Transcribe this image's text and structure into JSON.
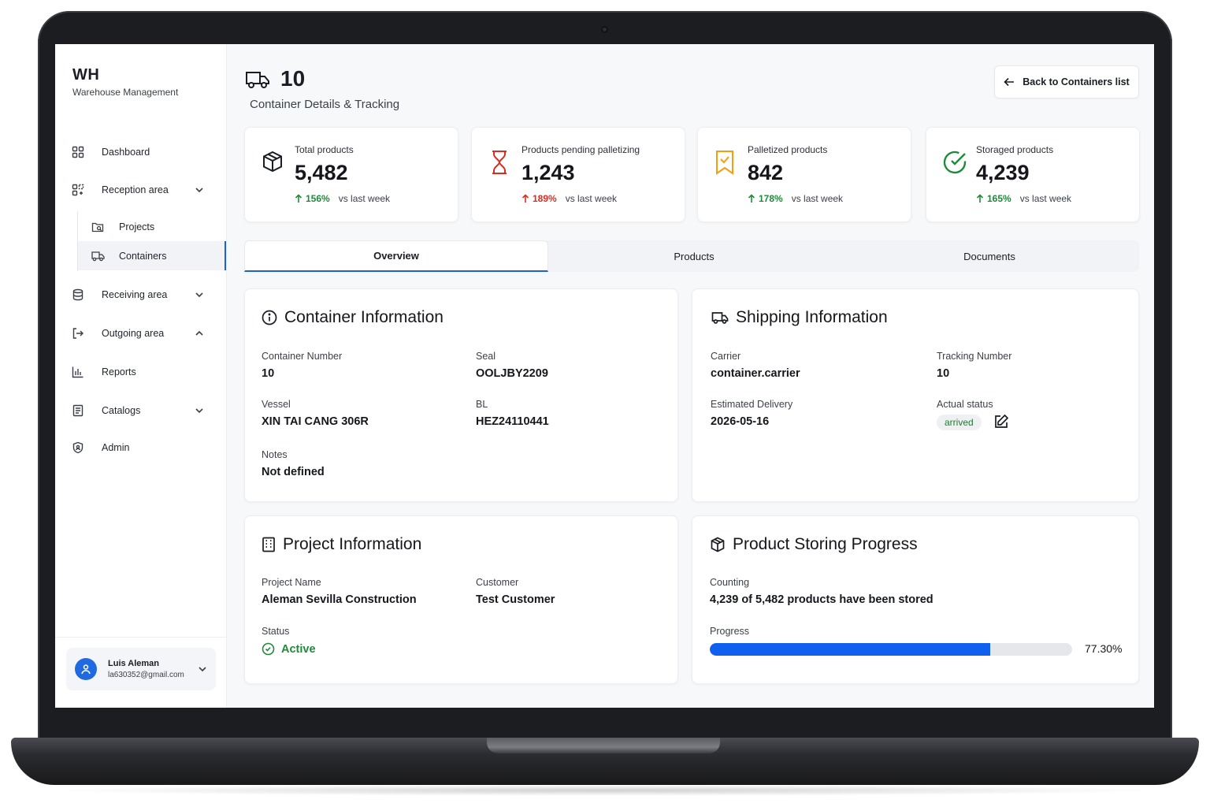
{
  "brand": {
    "title": "WH",
    "subtitle": "Warehouse Management"
  },
  "sidebar": {
    "items": [
      {
        "label": "Dashboard",
        "icon": "dashboard-grid-icon"
      },
      {
        "label": "Reception area",
        "icon": "reception-icon",
        "expanded": true
      },
      {
        "label": "Receiving area",
        "icon": "database-icon",
        "expanded": false
      },
      {
        "label": "Outgoing area",
        "icon": "exit-icon",
        "expanded": true
      },
      {
        "label": "Reports",
        "icon": "bar-chart-icon"
      },
      {
        "label": "Catalogs",
        "icon": "catalog-icon",
        "expanded": false
      },
      {
        "label": "Admin",
        "icon": "shield-icon"
      }
    ],
    "sub_items": [
      {
        "label": "Projects",
        "icon": "folder-search-icon"
      },
      {
        "label": "Containers",
        "icon": "truck-icon",
        "active": true
      }
    ]
  },
  "user": {
    "name": "Luis Aleman",
    "email": "la630352@gmail.com"
  },
  "header": {
    "title": "10",
    "subtitle": "Container Details & Tracking",
    "back_button": "Back to Containers list"
  },
  "stats": [
    {
      "label": "Total products",
      "value": "5,482",
      "change": "156%",
      "compare": "vs last week",
      "trend_color": "#1f8a3a",
      "icon": "box-icon"
    },
    {
      "label": "Products pending palletizing",
      "value": "1,243",
      "change": "189%",
      "compare": "vs last week",
      "trend_color": "#d92d20",
      "icon": "hourglass-icon"
    },
    {
      "label": "Palletized products",
      "value": "842",
      "change": "178%",
      "compare": "vs last week",
      "trend_color": "#1f8a3a",
      "icon": "bookmark-check-icon"
    },
    {
      "label": "Storaged products",
      "value": "4,239",
      "change": "165%",
      "compare": "vs last week",
      "trend_color": "#1f8a3a",
      "icon": "check-circle-icon"
    }
  ],
  "tabs": [
    {
      "label": "Overview",
      "active": true
    },
    {
      "label": "Products",
      "active": false
    },
    {
      "label": "Documents",
      "active": false
    }
  ],
  "container_info": {
    "title": "Container Information",
    "container_number_label": "Container Number",
    "container_number": "10",
    "seal_label": "Seal",
    "seal": "OOLJBY2209",
    "vessel_label": "Vessel",
    "vessel": "XIN TAI CANG 306R",
    "bl_label": "BL",
    "bl": "HEZ24110441",
    "notes_label": "Notes",
    "notes": "Not defined"
  },
  "shipping_info": {
    "title": "Shipping Information",
    "carrier_label": "Carrier",
    "carrier": "container.carrier",
    "tracking_label": "Tracking Number",
    "tracking": "10",
    "delivery_label": "Estimated Delivery",
    "delivery": "2026-05-16",
    "status_label": "Actual status",
    "status": "arrived"
  },
  "project_info": {
    "title": "Project Information",
    "project_name_label": "Project Name",
    "project_name": "Aleman Sevilla Construction",
    "customer_label": "Customer",
    "customer": "Test Customer",
    "status_label": "Status",
    "status": "Active"
  },
  "storing_progress": {
    "title": "Product Storing Progress",
    "counting_label": "Counting",
    "counting": "4,239 of 5,482 products have been stored",
    "progress_label": "Progress",
    "progress_text": "77.30%",
    "progress_fraction": 0.773
  },
  "colors": {
    "accent": "#1f5fd8",
    "progress": "#1060f0",
    "green": "#1f8a3a",
    "red": "#d92d20",
    "amber": "#f59e0b"
  }
}
